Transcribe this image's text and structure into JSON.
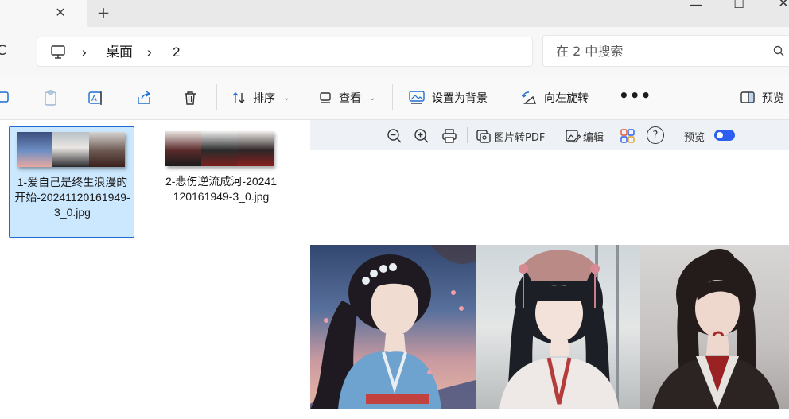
{
  "window": {
    "tab_close_glyph": "✕",
    "new_tab_glyph": "+",
    "minimize_glyph": "—",
    "maximize_glyph": "☐",
    "close_glyph": "✕"
  },
  "address": {
    "refresh_glyph": "C",
    "separator": "›",
    "crumbs": [
      "桌面",
      "2"
    ],
    "search_placeholder": "在 2 中搜索"
  },
  "commandbar": {
    "sort_label": "排序",
    "view_label": "查看",
    "set_background_label": "设置为背景",
    "rotate_left_label": "向左旋转",
    "more_label": "•••",
    "preview_label": "预览",
    "chevron": "⌄"
  },
  "files": [
    {
      "name": "1-爱自己是终生浪漫的开始-20241120161949-3_0.jpg",
      "selected": true
    },
    {
      "name": "2-悲伤逆流成河-20241120161949-3_0.jpg",
      "selected": false
    }
  ],
  "preview_toolbar": {
    "to_pdf_label": "图片转PDF",
    "edit_label": "编辑",
    "help_glyph": "?",
    "preview_label": "预览",
    "toggle_on": true
  },
  "colors": {
    "accent": "#2c5ff0",
    "selection_bg": "#cce8ff",
    "selection_border": "#1d6ad4"
  }
}
